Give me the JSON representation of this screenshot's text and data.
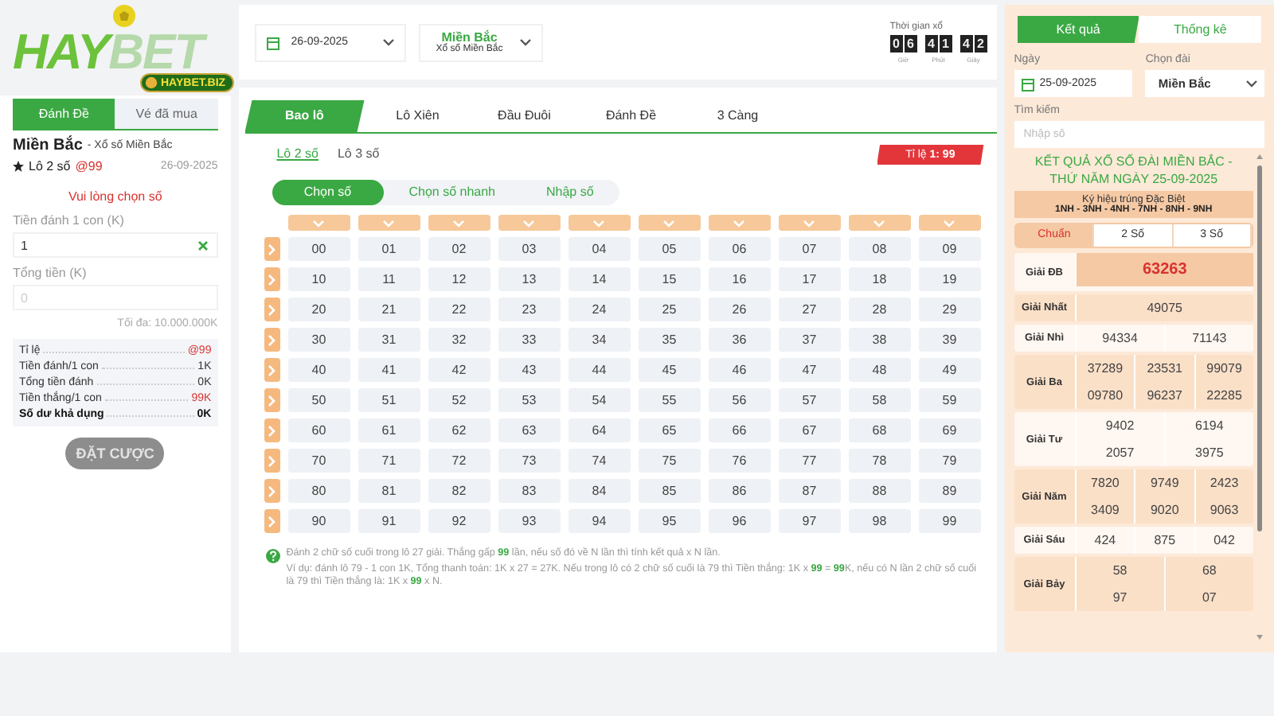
{
  "logo": {
    "text_1": "HAY",
    "text_2": "BET",
    "badge": "HAYBET.BIZ"
  },
  "left_panel": {
    "tabs": [
      {
        "label": "Đánh Đề",
        "selected": true
      },
      {
        "label": "Vé đã mua",
        "selected": false
      }
    ],
    "region": "Miền Bắc",
    "region_sub": "- Xổ số Miền Bắc",
    "bet_type": "Lô 2 số",
    "odds": "@99",
    "date": "26-09-2025",
    "notice": "Vui lòng chọn số",
    "fields": [
      {
        "label": "Tiền đánh 1 con (K)",
        "value": "1"
      },
      {
        "label": "Tổng tiền (K)",
        "placeholder": "0"
      }
    ],
    "limit": "Tối đa: 10.000.000K",
    "summary": [
      {
        "label": "Tỉ lệ",
        "value": "@99",
        "kind": "highlight"
      },
      {
        "label": "Tiền đánh/1 con",
        "value": "1K",
        "kind": "normal"
      },
      {
        "label": "Tổng tiền đánh",
        "value": "0K",
        "kind": "normal"
      },
      {
        "label": "Tiền thắng/1 con",
        "value": "99K",
        "kind": "highlight"
      },
      {
        "label": "Số dư khả dụng",
        "value": "0K",
        "kind": "total"
      }
    ],
    "submit": {
      "label": "ĐẶT CƯỢC",
      "disabled": true
    }
  },
  "top_bar": {
    "date": "26-09-2025",
    "region": {
      "title": "Miền Bắc",
      "subtitle": "Xổ số Miền Bắc"
    },
    "countdown": {
      "label": "Thời gian xổ",
      "groups": [
        {
          "digits": [
            "0",
            "6"
          ],
          "unit": "Giờ"
        },
        {
          "digits": [
            "4",
            "1"
          ],
          "unit": "Phút"
        },
        {
          "digits": [
            "4",
            "2"
          ],
          "unit": "Giây"
        }
      ]
    }
  },
  "main": {
    "tabs": [
      {
        "label": "Bao lô",
        "selected": true
      },
      {
        "label": "Lô Xiên",
        "selected": false
      },
      {
        "label": "Đầu Đuôi",
        "selected": false
      },
      {
        "label": "Đánh Đề",
        "selected": false
      },
      {
        "label": "3 Càng",
        "selected": false
      }
    ],
    "sub_tabs": [
      {
        "label": "Lô 2 số",
        "selected": true
      },
      {
        "label": "Lô 3 số",
        "selected": false
      }
    ],
    "odds_badge": "Tỉ lệ **1: 99**",
    "mode_tabs": [
      {
        "label": "Chọn số",
        "selected": true
      },
      {
        "label": "Chọn số nhanh",
        "selected": false
      },
      {
        "label": "Nhập số",
        "selected": false
      }
    ],
    "numbers": [
      [
        {
          "label": "00",
          "selected": false
        },
        {
          "label": "01",
          "selected": false
        },
        {
          "label": "02",
          "selected": false
        },
        {
          "label": "03",
          "selected": false
        },
        {
          "label": "04",
          "selected": false
        },
        {
          "label": "05",
          "selected": false
        },
        {
          "label": "06",
          "selected": false
        },
        {
          "label": "07",
          "selected": false
        },
        {
          "label": "08",
          "selected": false
        },
        {
          "label": "09",
          "selected": false
        }
      ],
      [
        {
          "label": "10",
          "selected": false
        },
        {
          "label": "11",
          "selected": false
        },
        {
          "label": "12",
          "selected": false
        },
        {
          "label": "13",
          "selected": false
        },
        {
          "label": "14",
          "selected": false
        },
        {
          "label": "15",
          "selected": false
        },
        {
          "label": "16",
          "selected": false
        },
        {
          "label": "17",
          "selected": false
        },
        {
          "label": "18",
          "selected": false
        },
        {
          "label": "19",
          "selected": false
        }
      ],
      [
        {
          "label": "20",
          "selected": false
        },
        {
          "label": "21",
          "selected": false
        },
        {
          "label": "22",
          "selected": false
        },
        {
          "label": "23",
          "selected": false
        },
        {
          "label": "24",
          "selected": false
        },
        {
          "label": "25",
          "selected": false
        },
        {
          "label": "26",
          "selected": false
        },
        {
          "label": "27",
          "selected": false
        },
        {
          "label": "28",
          "selected": false
        },
        {
          "label": "29",
          "selected": false
        }
      ],
      [
        {
          "label": "30",
          "selected": false
        },
        {
          "label": "31",
          "selected": false
        },
        {
          "label": "32",
          "selected": false
        },
        {
          "label": "33",
          "selected": false
        },
        {
          "label": "34",
          "selected": false
        },
        {
          "label": "35",
          "selected": false
        },
        {
          "label": "36",
          "selected": false
        },
        {
          "label": "37",
          "selected": false
        },
        {
          "label": "38",
          "selected": false
        },
        {
          "label": "39",
          "selected": false
        }
      ],
      [
        {
          "label": "40",
          "selected": false
        },
        {
          "label": "41",
          "selected": false
        },
        {
          "label": "42",
          "selected": false
        },
        {
          "label": "43",
          "selected": false
        },
        {
          "label": "44",
          "selected": false
        },
        {
          "label": "45",
          "selected": false
        },
        {
          "label": "46",
          "selected": false
        },
        {
          "label": "47",
          "selected": false
        },
        {
          "label": "48",
          "selected": false
        },
        {
          "label": "49",
          "selected": false
        }
      ],
      [
        {
          "label": "50",
          "selected": false
        },
        {
          "label": "51",
          "selected": false
        },
        {
          "label": "52",
          "selected": false
        },
        {
          "label": "53",
          "selected": false
        },
        {
          "label": "54",
          "selected": false
        },
        {
          "label": "55",
          "selected": false
        },
        {
          "label": "56",
          "selected": false
        },
        {
          "label": "57",
          "selected": false
        },
        {
          "label": "58",
          "selected": false
        },
        {
          "label": "59",
          "selected": false
        }
      ],
      [
        {
          "label": "60",
          "selected": false
        },
        {
          "label": "61",
          "selected": false
        },
        {
          "label": "62",
          "selected": false
        },
        {
          "label": "63",
          "selected": false
        },
        {
          "label": "64",
          "selected": false
        },
        {
          "label": "65",
          "selected": false
        },
        {
          "label": "66",
          "selected": false
        },
        {
          "label": "67",
          "selected": false
        },
        {
          "label": "68",
          "selected": false
        },
        {
          "label": "69",
          "selected": false
        }
      ],
      [
        {
          "label": "70",
          "selected": false
        },
        {
          "label": "71",
          "selected": false
        },
        {
          "label": "72",
          "selected": false
        },
        {
          "label": "73",
          "selected": false
        },
        {
          "label": "74",
          "selected": false
        },
        {
          "label": "75",
          "selected": false
        },
        {
          "label": "76",
          "selected": false
        },
        {
          "label": "77",
          "selected": false
        },
        {
          "label": "78",
          "selected": false
        },
        {
          "label": "79",
          "selected": false
        }
      ],
      [
        {
          "label": "80",
          "selected": false
        },
        {
          "label": "81",
          "selected": false
        },
        {
          "label": "82",
          "selected": false
        },
        {
          "label": "83",
          "selected": false
        },
        {
          "label": "84",
          "selected": false
        },
        {
          "label": "85",
          "selected": false
        },
        {
          "label": "86",
          "selected": false
        },
        {
          "label": "87",
          "selected": false
        },
        {
          "label": "88",
          "selected": false
        },
        {
          "label": "89",
          "selected": false
        }
      ],
      [
        {
          "label": "90",
          "selected": false
        },
        {
          "label": "91",
          "selected": false
        },
        {
          "label": "92",
          "selected": false
        },
        {
          "label": "93",
          "selected": false
        },
        {
          "label": "94",
          "selected": false
        },
        {
          "label": "95",
          "selected": false
        },
        {
          "label": "96",
          "selected": false
        },
        {
          "label": "97",
          "selected": false
        },
        {
          "label": "98",
          "selected": false
        },
        {
          "label": "99",
          "selected": false
        }
      ]
    ],
    "note": [
      "Đánh 2 chữ số cuối trong lô 27 giải. Thắng gấp **99** lần, nếu số đó về N lần thì tính kết quả x N lần.",
      "Ví dụ: đánh lô 79 - 1 con 1K, Tổng thanh toán: 1K x 27 = 27K. Nếu trong lô có 2 chữ số cuối là 79 thì Tiền thắng: 1K x **99** = **99**K, nếu có N lần 2 chữ số cuối là 79 thì Tiền thắng là: 1K x **99** x N."
    ]
  },
  "right_panel": {
    "tabs": [
      {
        "label": "Kết quả",
        "selected": true
      },
      {
        "label": "Thống kê",
        "selected": false
      }
    ],
    "date_label": "Ngày",
    "date": "25-09-2025",
    "region_label": "Chọn đài",
    "region": "Miền Bắc",
    "search_label": "Tìm kiếm",
    "search_placeholder": "Nhập số",
    "title": "KẾT QUẢ XỔ SỐ ĐÀI MIỀN BẮC - THỨ NĂM NGÀY 25-09-2025",
    "special_code": {
      "title": "Ký hiệu trúng Đặc Biệt",
      "codes": "1NH - 3NH - 4NH - 7NH - 8NH - 9NH"
    },
    "digit_tabs": [
      {
        "label": "Chuẩn",
        "selected": true
      },
      {
        "label": "2 Số",
        "selected": false
      },
      {
        "label": "3 Số",
        "selected": false
      }
    ],
    "results": [
      {
        "name": "Giải ĐB",
        "numbers": [
          "63263"
        ],
        "kind": "special"
      },
      {
        "name": "Giải Nhất",
        "numbers": [
          "49075"
        ],
        "kind": "normal"
      },
      {
        "name": "Giải Nhì",
        "numbers": [
          "94334",
          "71143"
        ],
        "kind": "normal"
      },
      {
        "name": "Giải Ba",
        "numbers": [
          "37289",
          "23531",
          "99079",
          "09780",
          "96237",
          "22285"
        ],
        "kind": "normal"
      },
      {
        "name": "Giải Tư",
        "numbers": [
          "9402",
          "6194",
          "2057",
          "3975"
        ],
        "kind": "normal"
      },
      {
        "name": "Giải Năm",
        "numbers": [
          "7820",
          "9749",
          "2423",
          "3409",
          "9020",
          "9063"
        ],
        "kind": "normal"
      },
      {
        "name": "Giải Sáu",
        "numbers": [
          "424",
          "875",
          "042"
        ],
        "kind": "normal"
      },
      {
        "name": "Giải Bảy",
        "numbers": [
          "58",
          "68",
          "97",
          "07"
        ],
        "kind": "normal"
      }
    ]
  }
}
